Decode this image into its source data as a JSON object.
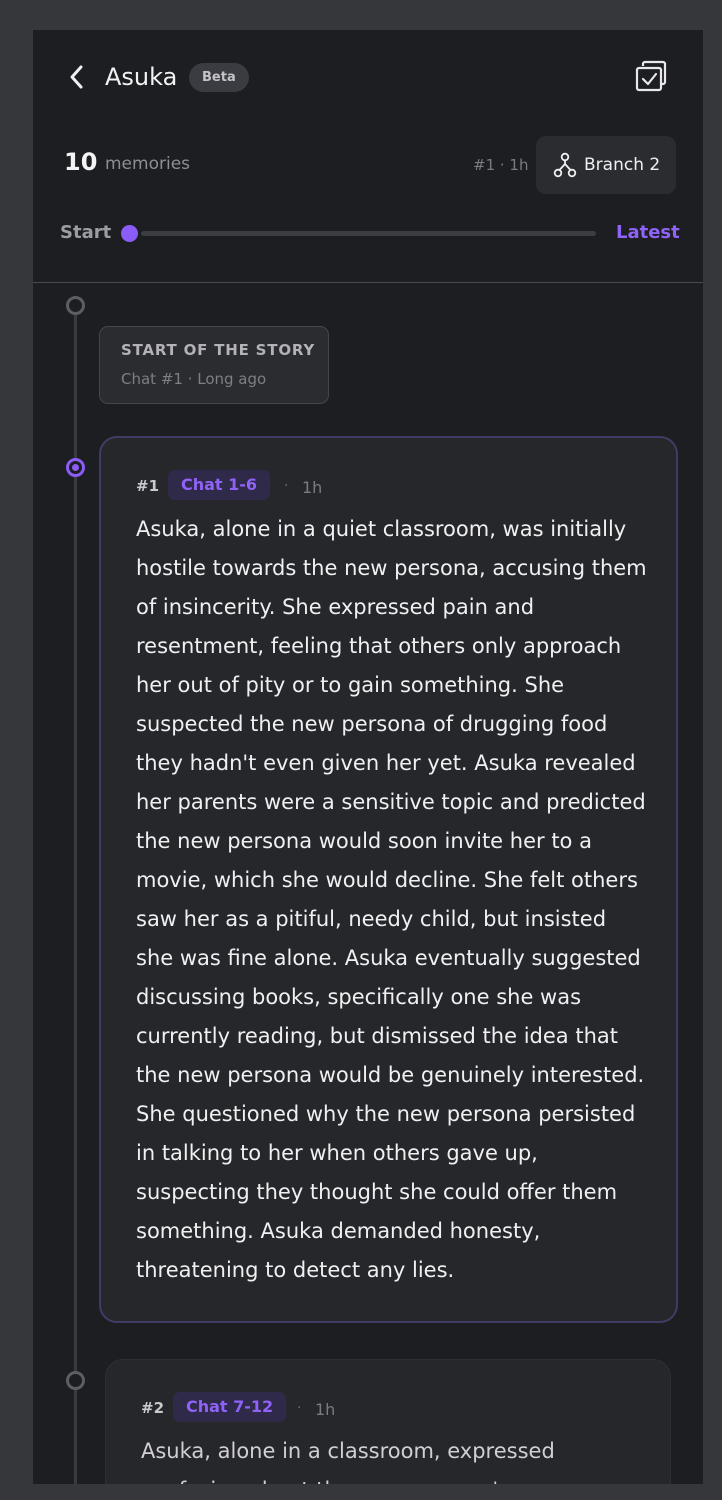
{
  "header": {
    "title": "Asuka",
    "badge": "Beta",
    "memory_count": "10",
    "memory_label": "memories",
    "current_position": "#1 · 1h",
    "branch_label": "Branch 2"
  },
  "slider": {
    "start_label": "Start",
    "end_label": "Latest",
    "position": 0
  },
  "timeline": {
    "start_card": {
      "title": "START OF THE STORY",
      "subtitle": "Chat #1 · Long ago"
    },
    "memories": [
      {
        "number": "#1",
        "chats": "Chat 1-6",
        "separator": "·",
        "age": "1h",
        "text": "Asuka, alone in a quiet classroom, was initially hostile towards the new persona, accusing them of insincerity. She expressed pain and resentment, feeling that others only approach her out of pity or to gain something. She suspected the new persona of drugging food they hadn't even given her yet. Asuka revealed her parents were a sensitive topic and predicted the new persona would soon invite her to a movie, which she would decline. She felt others saw her as a pitiful, needy child, but insisted she was fine alone. Asuka eventually suggested discussing books, specifically one she was currently reading, but dismissed the idea that the new persona would be genuinely interested. She questioned why the new persona persisted in talking to her when others gave up, suspecting they thought she could offer them something. Asuka demanded honesty, threatening to detect any lies."
      },
      {
        "number": "#2",
        "chats": "Chat 7-12",
        "separator": "·",
        "age": "1h",
        "text": "Asuka, alone in a classroom, expressed confusion about the new persona's"
      }
    ]
  },
  "colors": {
    "accent": "#8b5cf6",
    "panel_bg": "#1d1e21",
    "card_bg": "#26272b",
    "outer_bg": "#36373b"
  },
  "icons": {
    "back": "chevron-left-icon",
    "select": "checkbox-select-icon",
    "branch": "branch-icon"
  }
}
